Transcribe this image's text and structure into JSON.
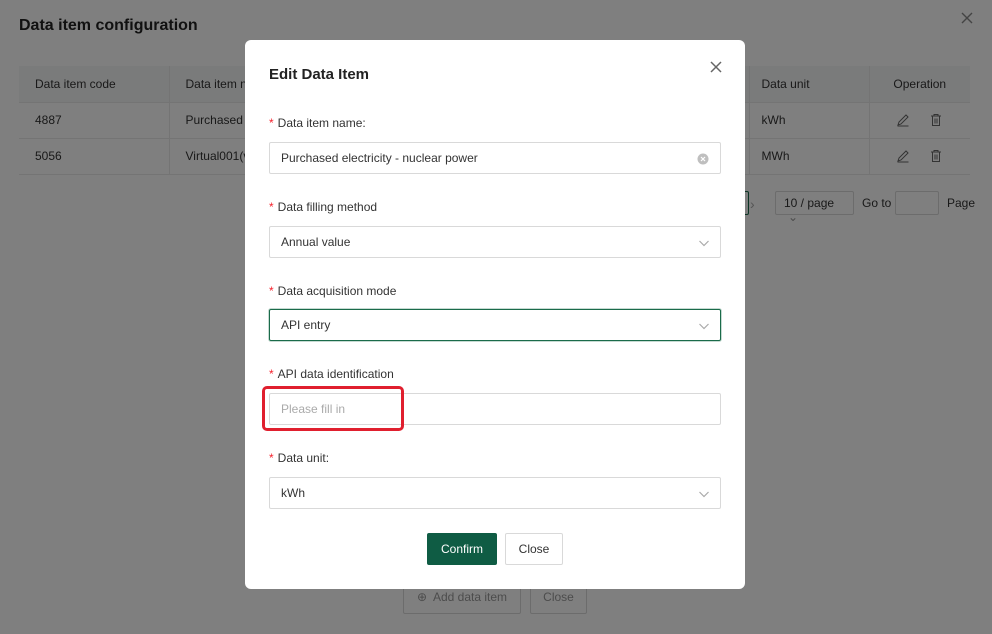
{
  "background": {
    "title": "Data item configuration",
    "table": {
      "headers": [
        "Data item code",
        "Data item na",
        "Data unit",
        "Operation"
      ],
      "rows": [
        {
          "code": "4887",
          "name": "Purchased el",
          "unit": "kWh"
        },
        {
          "code": "5056",
          "name": "Virtual001(vi",
          "unit": "MWh"
        }
      ]
    },
    "pagination": {
      "page_size": "10 / page",
      "goto_label": "Go to",
      "page_label": "Page"
    },
    "buttons": {
      "add_label": "Add data item",
      "close_label": "Close"
    }
  },
  "modal": {
    "title": "Edit Data Item",
    "required_mark": "*",
    "fields": {
      "name": {
        "label": "Data item name:",
        "value": "Purchased electricity - nuclear power"
      },
      "filling_method": {
        "label": "Data filling method",
        "value": "Annual value"
      },
      "acquisition_mode": {
        "label": "Data acquisition mode",
        "value": "API entry"
      },
      "api_id": {
        "label": "API data identification",
        "placeholder": "Please fill in"
      },
      "unit": {
        "label": "Data unit:",
        "value": "kWh"
      }
    },
    "buttons": {
      "confirm_label": "Confirm",
      "close_label": "Close"
    }
  },
  "colors": {
    "primary": "#0f5c44",
    "required": "#f5222d",
    "highlight": "#e01f2e"
  }
}
